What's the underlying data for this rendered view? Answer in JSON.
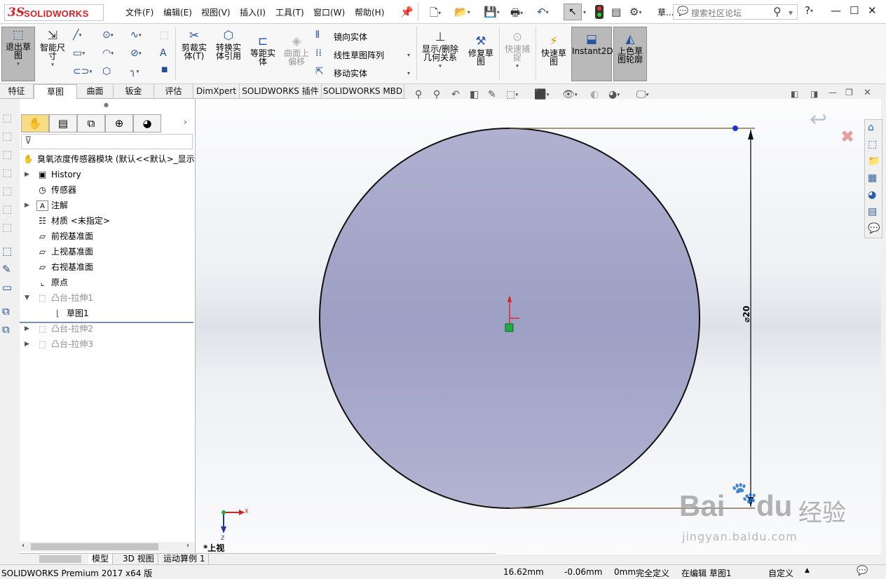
{
  "app": {
    "brand_ds": "3S",
    "brand_name": "SOLIDWORKS"
  },
  "menu": [
    "文件(F)",
    "编辑(E)",
    "视图(V)",
    "插入(I)",
    "工具(T)",
    "窗口(W)",
    "帮助(H)"
  ],
  "toolbar_extra": "草...",
  "search": {
    "placeholder": "搜索社区论坛"
  },
  "ribbon": {
    "exit_sketch": "退出草\n图",
    "smart_dim": "智能尺\n寸",
    "trim": "剪裁实\n体(T)",
    "convert": "转换实\n体引用",
    "offset": "等距实\n体",
    "surface_offset": "曲面上\n偏移",
    "mirror": "镜向实体",
    "linear_pattern": "线性草图阵列",
    "move": "移动实体",
    "show_delete": "显示/删除\n几何关系",
    "repair": "修复草\n图",
    "quick_snap": "快速捕\n捉",
    "rapid_sketch": "快速草\n图",
    "instant2d": "Instant2D",
    "shaded_contour": "上色草\n图轮廓"
  },
  "command_tabs": [
    "特征",
    "草图",
    "曲面",
    "钣金",
    "评估",
    "DimXpert",
    "SOLIDWORKS 插件",
    "SOLIDWORKS MBD"
  ],
  "active_tab": "草图",
  "tree": {
    "root": "臭氧浓度传感器模块 (默认<<默认>_显示",
    "items": [
      {
        "label": "History"
      },
      {
        "label": "传感器"
      },
      {
        "label": "注解"
      },
      {
        "label": "材质 <未指定>"
      },
      {
        "label": "前视基准面"
      },
      {
        "label": "上视基准面"
      },
      {
        "label": "右视基准面"
      },
      {
        "label": "原点"
      },
      {
        "label": "凸台-拉伸1"
      },
      {
        "label": "草图1"
      },
      {
        "label": "凸台-拉伸2"
      },
      {
        "label": "凸台-拉伸3"
      }
    ]
  },
  "viewport": {
    "view_name": "*上视",
    "dimension_label": "⌀20",
    "triad_x": "X",
    "triad_z": "Z",
    "sketch_fill": "#9d9fc4"
  },
  "bottom_tabs": [
    "模型",
    "3D 视图",
    "运动算例 1"
  ],
  "status": {
    "product": "SOLIDWORKS Premium 2017 x64 版",
    "x": "16.62mm",
    "y": "-0.06mm",
    "z": "0mm",
    "state": "完全定义",
    "editing": "在编辑 草图1",
    "units": "自定义"
  },
  "watermark": {
    "brand": "Bai",
    "brand_b": "du",
    "cn": "经验",
    "url": "jingyan.baidu.com"
  }
}
